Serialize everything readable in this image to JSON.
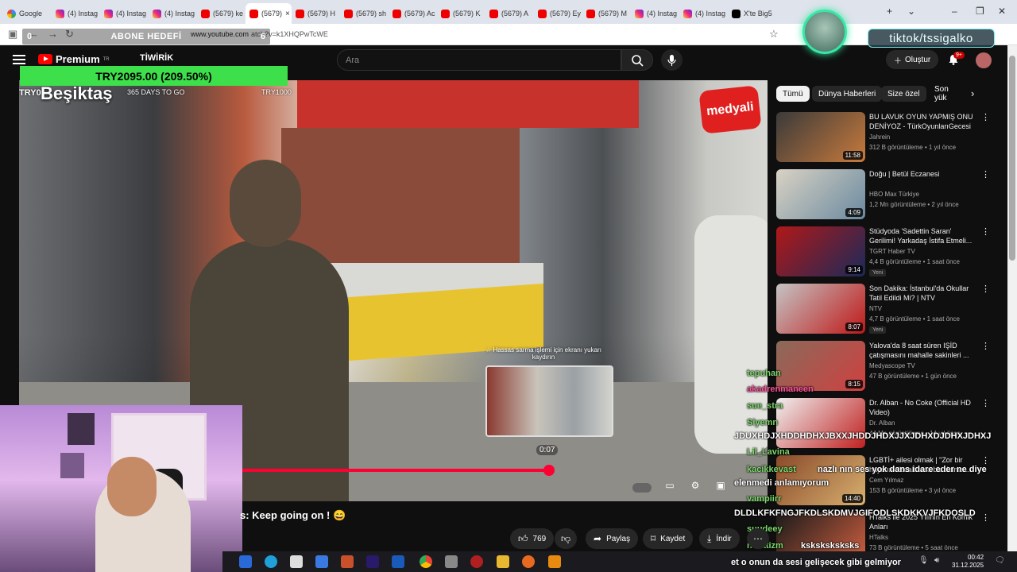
{
  "browser": {
    "tabs": [
      {
        "label": "Google",
        "icon": "g",
        "active": false
      },
      {
        "label": "(4) Instag",
        "icon": "ig",
        "active": false
      },
      {
        "label": "(4) Instag",
        "icon": "ig",
        "active": false
      },
      {
        "label": "(4) Instag",
        "icon": "ig",
        "active": false
      },
      {
        "label": "(5679) ke",
        "icon": "yt",
        "active": false
      },
      {
        "label": "(5679)",
        "icon": "yt",
        "active": true
      },
      {
        "label": "(5679) H",
        "icon": "yt",
        "active": false
      },
      {
        "label": "(5679) sh",
        "icon": "yt",
        "active": false
      },
      {
        "label": "(5679) Ac",
        "icon": "yt",
        "active": false
      },
      {
        "label": "(5679) K",
        "icon": "yt",
        "active": false
      },
      {
        "label": "(5679) A",
        "icon": "yt",
        "active": false
      },
      {
        "label": "(5679) Ey",
        "icon": "yt",
        "active": false
      },
      {
        "label": "(5679) M",
        "icon": "yt",
        "active": false
      },
      {
        "label": "(4) Instag",
        "icon": "ig",
        "active": false
      },
      {
        "label": "(4) Instag",
        "icon": "ig",
        "active": false
      },
      {
        "label": "X'te Big5",
        "icon": "x",
        "active": false
      }
    ],
    "active_tab_close": "×",
    "url_host": "www.youtube.com",
    "url_path": "atch?v=k1XHQPwTcWE"
  },
  "overlay": {
    "abone_left": "0",
    "abone_label": "ABONE HEDEFİ",
    "abone_right": "6",
    "tiktok": "tiktok/tssigalko",
    "green_bar": "TRY2095.00 (209.50%)",
    "try_left": "TRY0",
    "days": "365 DAYS TO GO",
    "try_right": "TRY1000",
    "besiktas": "Beşiktaş",
    "medyali": "medyali",
    "hint": "☆ Hassas sarma işlemi için ekranı yukarı kaydırın",
    "time_tip": "0:07",
    "caption": "s: Keep going on ! 😄",
    "ticker": "et o onun da sesi gelişecek gibi gelmiyor"
  },
  "youtube": {
    "premium": "Premium",
    "premium_sup": "TR",
    "tiwirik": "TİWİRİK",
    "search_placeholder": "Ara",
    "create": "Oluştur",
    "notif_badge": "9+"
  },
  "actions": {
    "likes": "769",
    "share": "Paylaş",
    "save": "Kaydet",
    "download": "İndir"
  },
  "chips": [
    "Tümü",
    "Dünya Haberleri",
    "Size özel",
    "Son yük"
  ],
  "recommendations": [
    {
      "title": "BU LAVUK OYUN YAPMIŞ ONU DENİYOZ - TürkOyunlarıGecesi",
      "channel": "Jahrein",
      "meta": "312 B görüntüleme • 1 yıl önce",
      "duration": "11:58",
      "new": "",
      "color1": "#3a3a3a",
      "color2": "#c87a3c"
    },
    {
      "title": "Doğu | Betül Eczanesi",
      "channel": "HBO Max Türkiye",
      "meta": "1,2 Mn görüntüleme • 2 yıl önce",
      "duration": "4:09",
      "new": "",
      "color1": "#d9d2c4",
      "color2": "#6a8aa0"
    },
    {
      "title": "Stüdyoda 'Sadettin Saran' Gerilimi! Yarkadaş İstifa Etmeli...",
      "channel": "TGRT Haber TV",
      "meta": "4,4 B görüntüleme • 1 saat önce",
      "duration": "9:14",
      "new": "Yeni",
      "color1": "#b01818",
      "color2": "#1a2a5a"
    },
    {
      "title": "Son Dakika: İstanbul'da Okullar Tatil Edildi Mi? | NTV",
      "channel": "NTV",
      "meta": "4,7 B görüntüleme • 1 saat önce",
      "duration": "8:07",
      "new": "Yeni",
      "color1": "#c4c4c4",
      "color2": "#c01818"
    },
    {
      "title": "Yalova'da 8 saat süren IŞİD çatışmasını mahalle sakinleri ...",
      "channel": "Medyascope TV",
      "meta": "47 B görüntüleme • 1 gün önce",
      "duration": "8:15",
      "new": "",
      "color1": "#8a6a5a",
      "color2": "#d04040"
    },
    {
      "title": "Dr. Alban - No Coke (Official HD Video)",
      "channel": "Dr. Alban",
      "meta": "44 Mn görüntüleme • 14 yıl önce",
      "duration": "",
      "new": "",
      "color1": "#f0f0f0",
      "color2": "#c02020"
    },
    {
      "title": "LGBTİ+ ailesi olmak | \"Zor bir hayatın olacak ama biz daima ...",
      "channel": "Cem Yılmaz",
      "meta": "153 B görüntüleme • 3 yıl önce",
      "duration": "14:40",
      "new": "",
      "color1": "#8a4a2a",
      "color2": "#d8b070"
    },
    {
      "title": "HTalks ile 2025 Yılının En Komik Anları",
      "channel": "HTalks",
      "meta": "73 B görüntüleme • 5 saat önce",
      "duration": "25:27",
      "new": "Yeni",
      "color1": "#1a1a1a",
      "color2": "#d06040"
    }
  ],
  "chat": [
    {
      "nick": "tepuhan",
      "msg": ""
    },
    {
      "nick": "akadrenmaneen",
      "msg": "",
      "pink": true
    },
    {
      "nick": "sue_stra",
      "msg": ""
    },
    {
      "nick": "Siyemn",
      "msg": ""
    },
    {
      "nick": "",
      "msg": "JDUXHDJXHDDHDHXJBXXJHDDJHDXJJXJDHXDJDHXJDHXJ"
    },
    {
      "nick": "Lil_Lavina",
      "msg": ""
    },
    {
      "nick": "kacikkevast",
      "msg": "nazlı nın ses yok dans idare eder ne diye"
    },
    {
      "nick": "",
      "msg": "elenmedi anlamıyorum"
    },
    {
      "nick": "vampiirr",
      "msg": ""
    },
    {
      "nick": "",
      "msg": "DLDLKFKFNGJFKDLSKDMVJGIFODLSKDKKVJFKDOSLD"
    },
    {
      "nick": "suudeey",
      "msg": ""
    },
    {
      "nick": "nuratizm",
      "msg": "ksksksksksks"
    }
  ],
  "system": {
    "time": "00:42",
    "date": "31.12.2025"
  }
}
